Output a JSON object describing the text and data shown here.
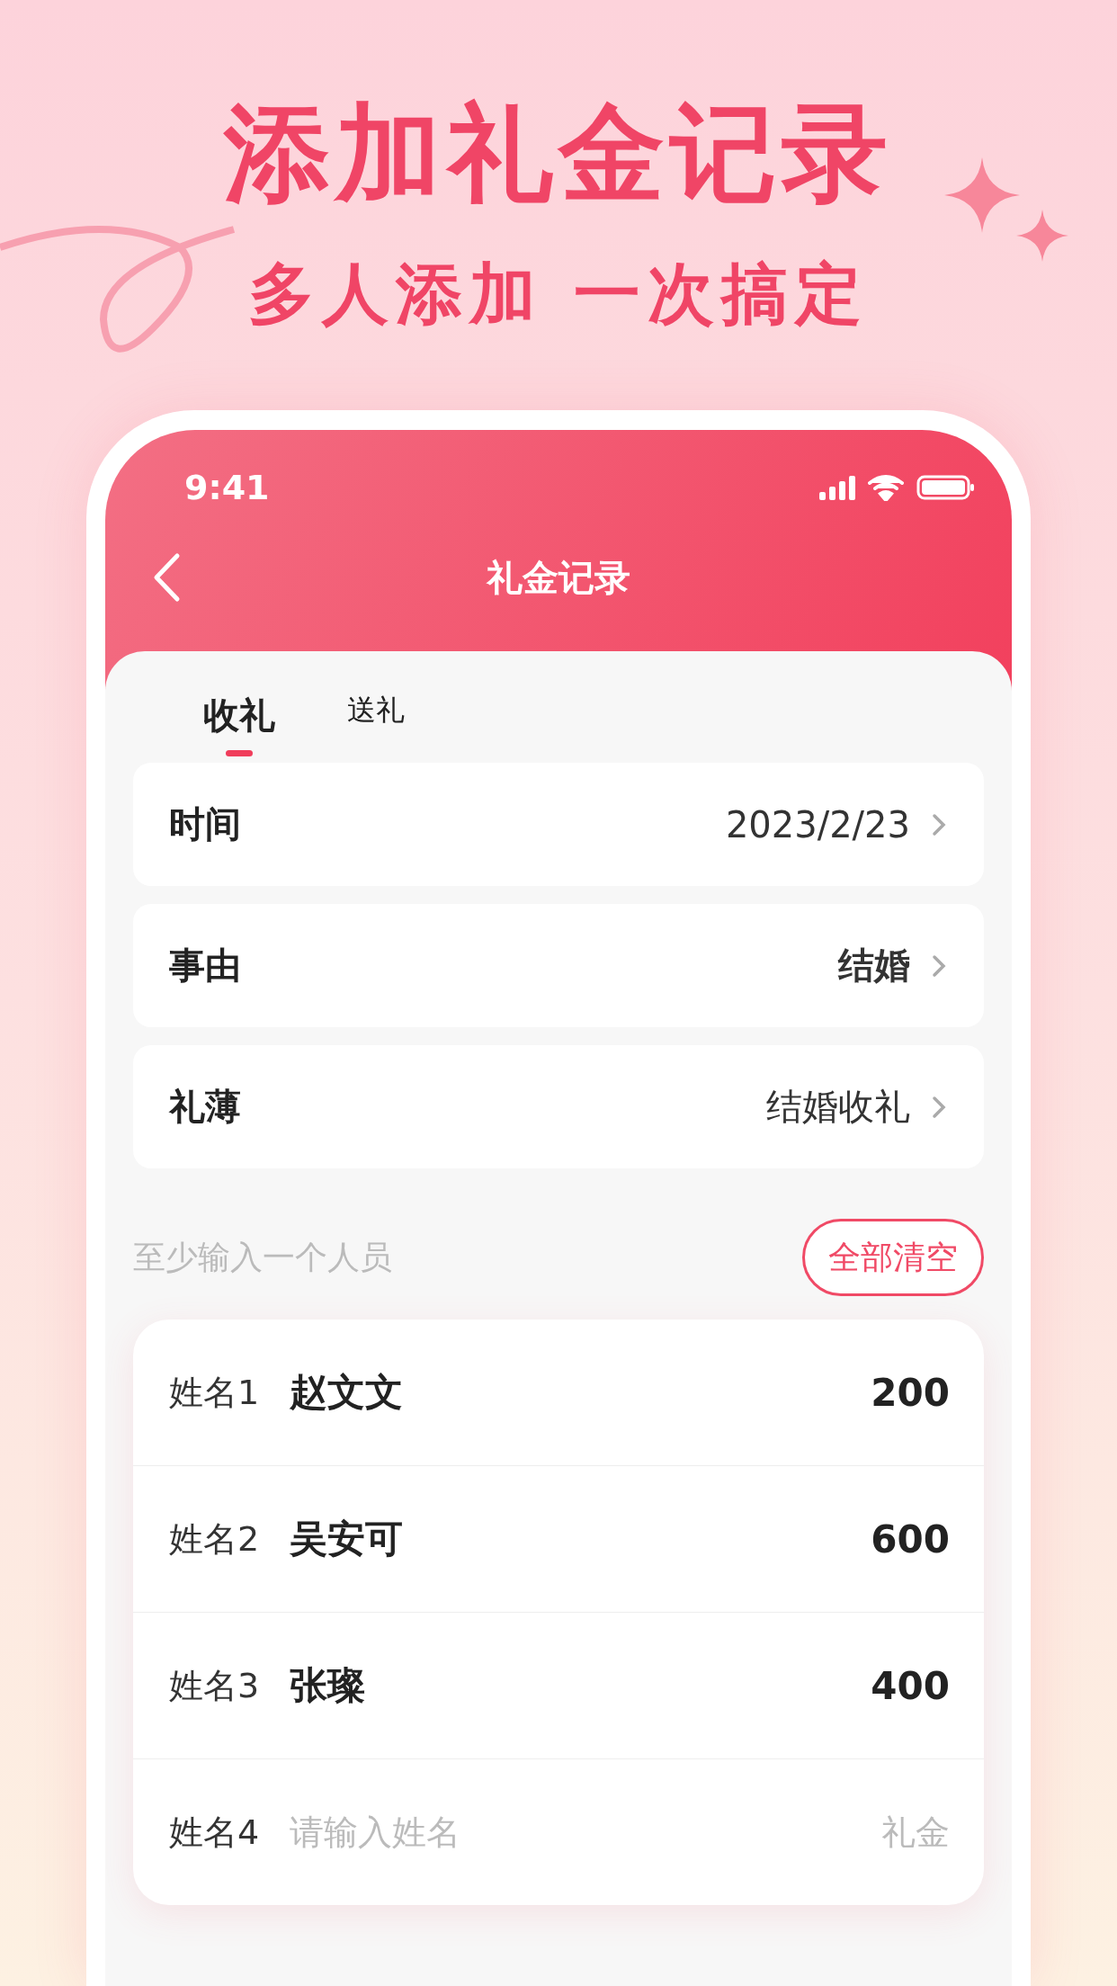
{
  "headline": "添加礼金记录",
  "subheadline": "多人添加 一次搞定",
  "status_bar": {
    "time": "9:41"
  },
  "nav": {
    "title": "礼金记录"
  },
  "tabs": [
    {
      "label": "收礼",
      "selected": true
    },
    {
      "label": "送礼",
      "selected": false
    }
  ],
  "fields": [
    {
      "label": "时间",
      "value": "2023/2/23",
      "emphasized": false
    },
    {
      "label": "事由",
      "value": "结婚",
      "emphasized": true
    },
    {
      "label": "礼薄",
      "value": "结婚收礼",
      "emphasized": false
    }
  ],
  "hint": "至少输入一个人员",
  "clear_button": "全部清空",
  "people": [
    {
      "label": "姓名1",
      "name": "赵文文",
      "amount": "200"
    },
    {
      "label": "姓名2",
      "name": "吴安可",
      "amount": "600"
    },
    {
      "label": "姓名3",
      "name": "张璨",
      "amount": "400"
    },
    {
      "label": "姓名4",
      "name_placeholder": "请输入姓名",
      "amount_placeholder": "礼金"
    }
  ]
}
